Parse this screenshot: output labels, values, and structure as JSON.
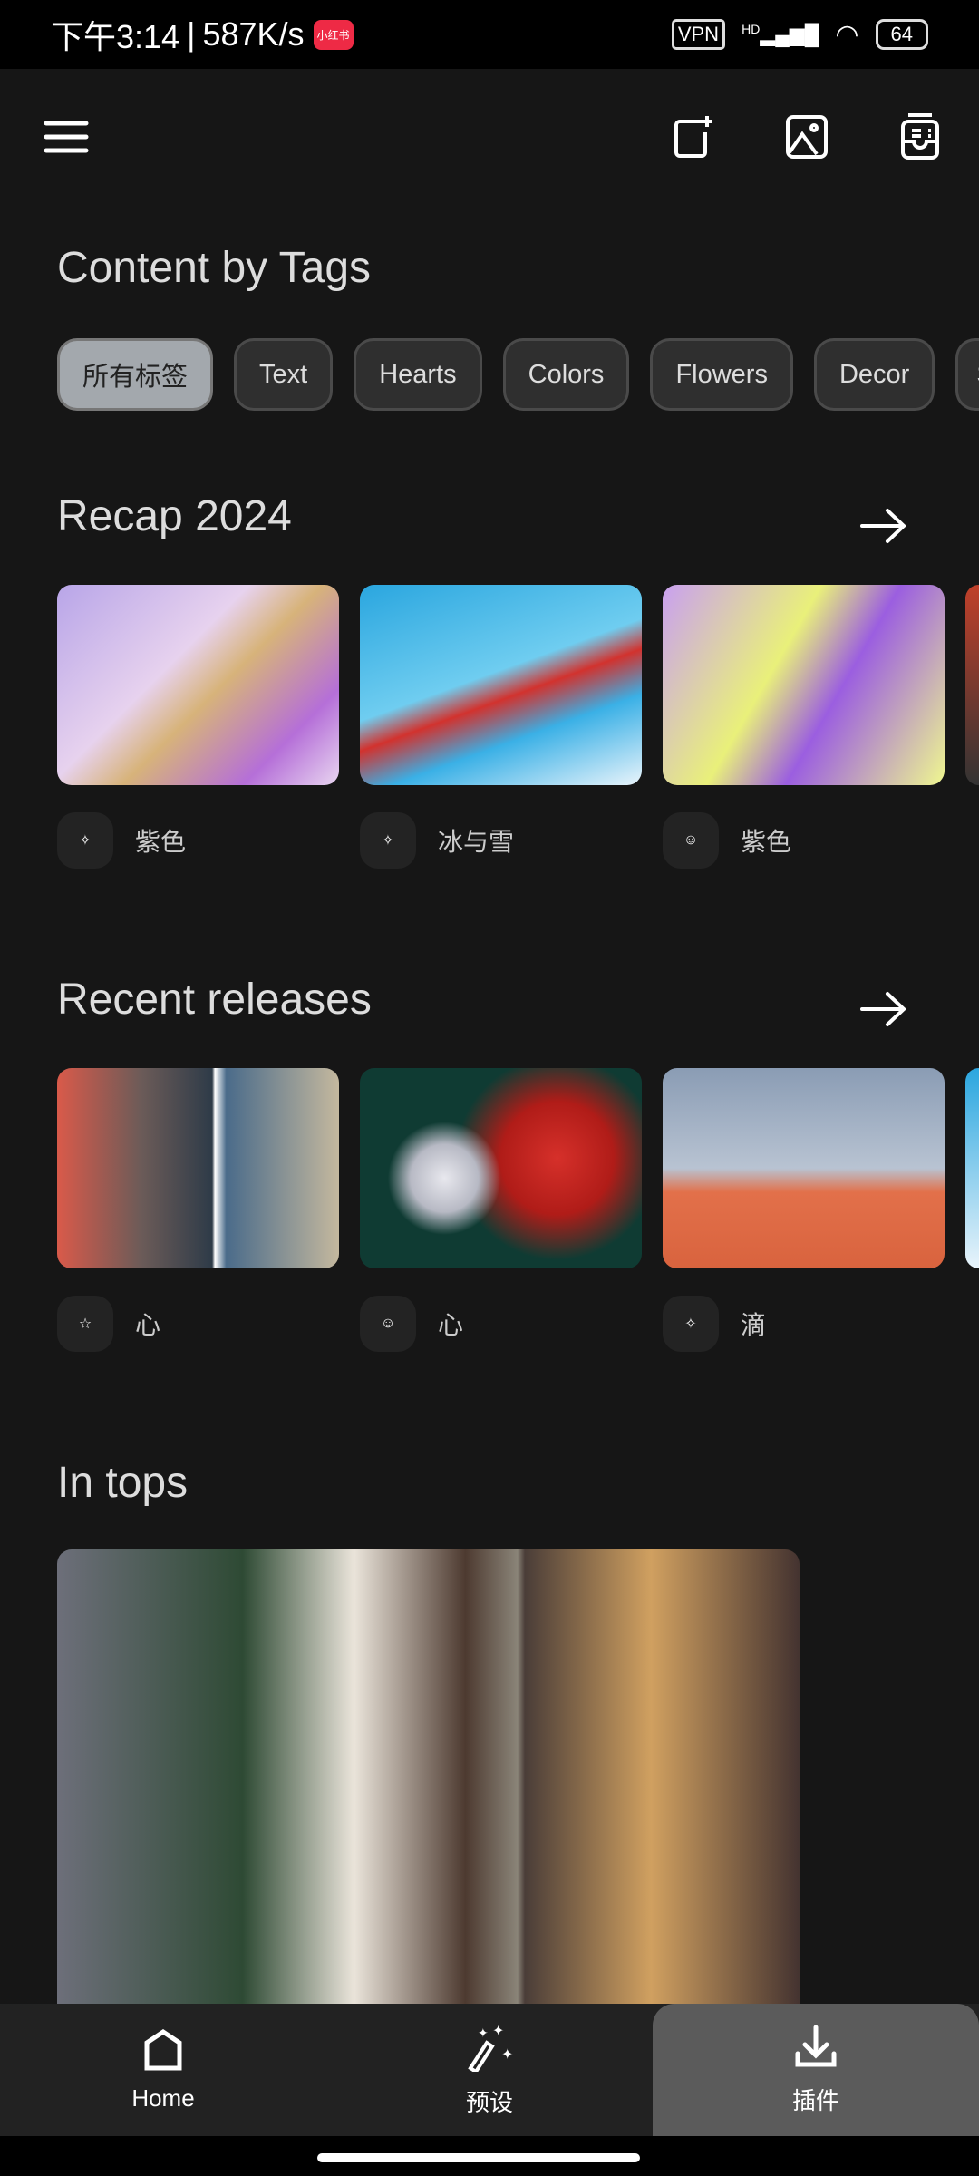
{
  "status_bar": {
    "time": "下午3:14",
    "speed": "587K/s",
    "app_badge": "小红书",
    "vpn": "VPN",
    "network": "HD",
    "battery": "64"
  },
  "app_bar": {
    "icons": [
      "menu-icon",
      "new-canvas-icon",
      "gallery-icon",
      "inbox-icon"
    ]
  },
  "tags_section": {
    "title": "Content by Tags",
    "chips": [
      "所有标签",
      "Text",
      "Hearts",
      "Colors",
      "Flowers",
      "Decor",
      "S"
    ],
    "selected": "所有标签"
  },
  "recap": {
    "title": "Recap 2024",
    "cards": [
      {
        "tag": "紫色",
        "icon": "sparkle-icon"
      },
      {
        "tag": "冰与雪",
        "icon": "sparkle-icon"
      },
      {
        "tag": "紫色",
        "icon": "sticker-icon"
      }
    ]
  },
  "recent": {
    "title": "Recent releases",
    "cards": [
      {
        "tag": "心",
        "icon": "star-icon"
      },
      {
        "tag": "心",
        "icon": "sticker-icon"
      },
      {
        "tag": "滴",
        "icon": "sparkle-icon"
      }
    ]
  },
  "tops": {
    "title": "In tops"
  },
  "nav": {
    "tabs": [
      {
        "label": "Home",
        "icon": "home-icon"
      },
      {
        "label": "预设",
        "icon": "magic-wand-icon"
      },
      {
        "label": "插件",
        "icon": "download-icon"
      }
    ],
    "selected": "插件"
  }
}
